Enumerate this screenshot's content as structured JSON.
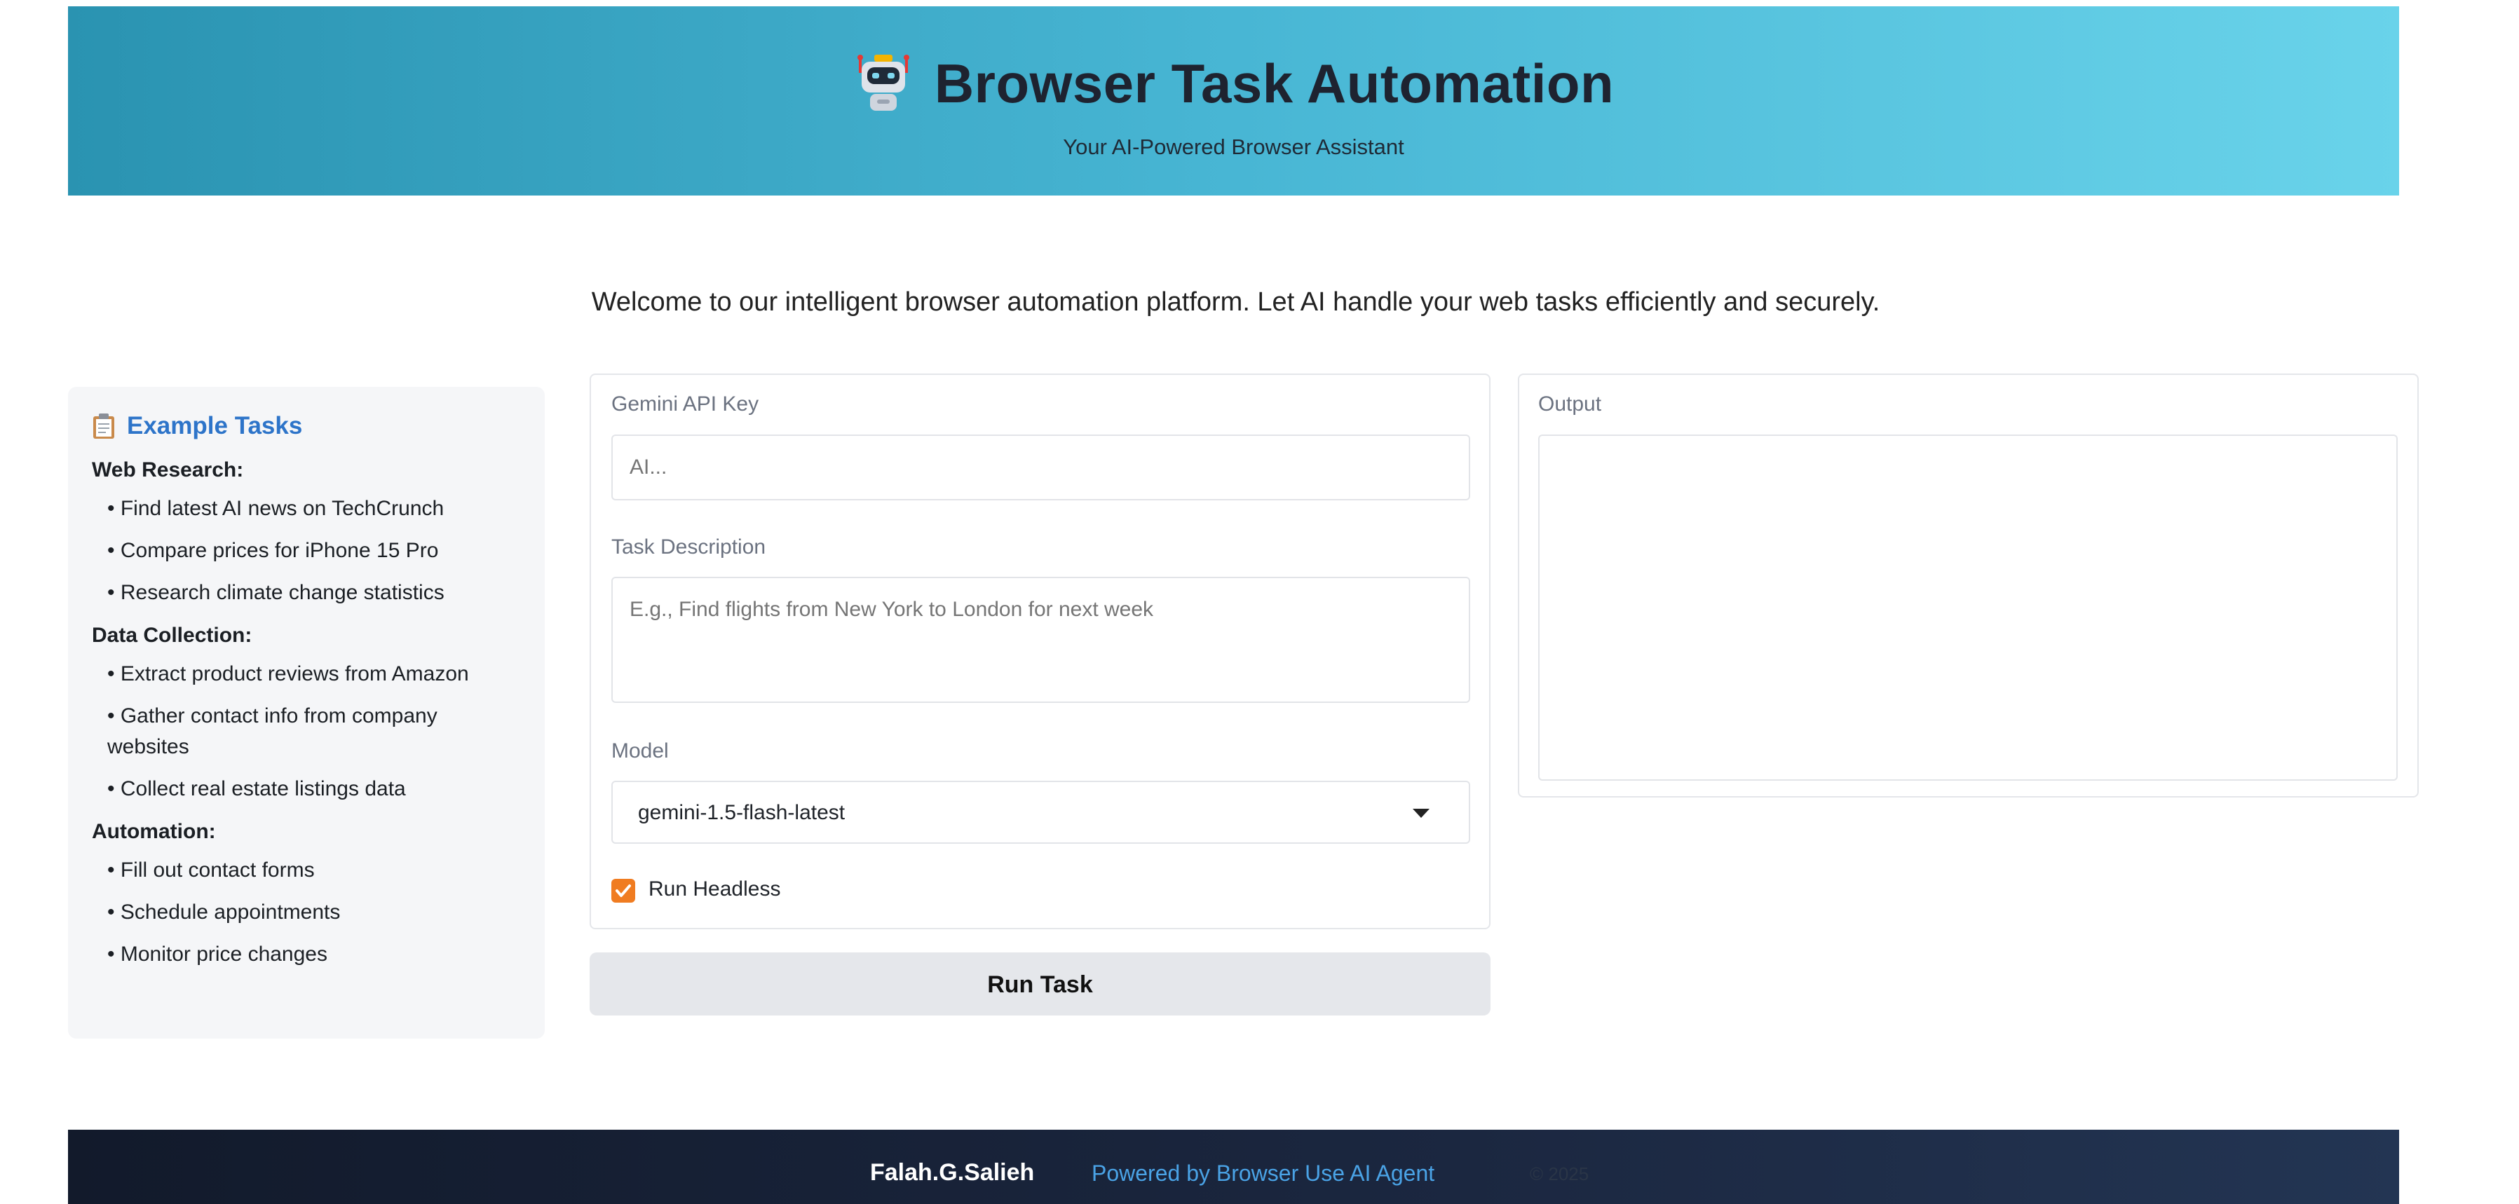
{
  "header": {
    "icon": "robot-icon",
    "title": "Browser Task Automation",
    "subtitle": "Your AI-Powered Browser Assistant"
  },
  "welcome": "Welcome to our intelligent browser automation platform. Let AI handle your web tasks efficiently and securely.",
  "sidebar": {
    "icon": "clipboard-icon",
    "title": "Example Tasks",
    "sections": [
      {
        "heading": "Web Research:",
        "items": [
          "• Find latest AI news on TechCrunch",
          "• Compare prices for iPhone 15 Pro",
          "• Research climate change statistics"
        ]
      },
      {
        "heading": "Data Collection:",
        "items": [
          "• Extract product reviews from Amazon",
          "• Gather contact info from company websites",
          "• Collect real estate listings data"
        ]
      },
      {
        "heading": "Automation:",
        "items": [
          "• Fill out contact forms",
          "• Schedule appointments",
          "• Monitor price changes"
        ]
      }
    ]
  },
  "form": {
    "api_key_label": "Gemini API Key",
    "api_key_placeholder": "AI...",
    "api_key_value": "",
    "task_label": "Task Description",
    "task_placeholder": "E.g., Find flights from New York to London for next week",
    "task_value": "",
    "model_label": "Model",
    "model_value": "gemini-1.5-flash-latest",
    "headless_label": "Run Headless",
    "headless_checked": true,
    "run_button": "Run Task"
  },
  "output": {
    "label": "Output",
    "value": ""
  },
  "footer": {
    "author": "Falah.G.Salieh",
    "powered": "Powered by Browser Use AI Agent",
    "year": "© 2025"
  },
  "colors": {
    "header_gradient_start": "#2a93b1",
    "header_gradient_end": "#69d3ea",
    "accent_orange": "#f07c21",
    "link_blue": "#2d74c9",
    "footer_bg": "#121a2b"
  }
}
